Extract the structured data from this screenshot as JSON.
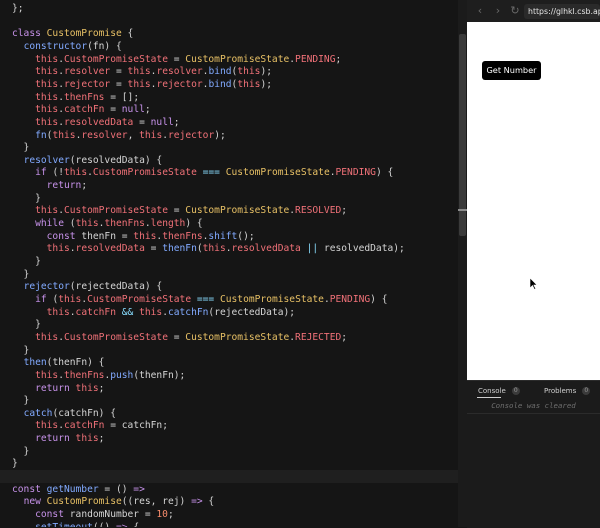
{
  "editor": {
    "lines": [
      [
        [
          "p",
          "};"
        ]
      ],
      [
        [
          "p",
          ""
        ]
      ],
      [
        [
          "k",
          "class "
        ],
        [
          "c",
          "CustomPromise"
        ],
        [
          "p",
          " {"
        ]
      ],
      [
        [
          "p",
          "  "
        ],
        [
          "f",
          "constructor"
        ],
        [
          "p",
          "(fn) {"
        ]
      ],
      [
        [
          "p",
          "    "
        ],
        [
          "t",
          "this"
        ],
        [
          "p",
          "."
        ],
        [
          "r",
          "CustomPromiseState"
        ],
        [
          "p",
          " = "
        ],
        [
          "c",
          "CustomPromiseState"
        ],
        [
          "p",
          "."
        ],
        [
          "r",
          "PENDING"
        ],
        [
          "p",
          ";"
        ]
      ],
      [
        [
          "p",
          "    "
        ],
        [
          "t",
          "this"
        ],
        [
          "p",
          "."
        ],
        [
          "r",
          "resolver"
        ],
        [
          "p",
          " = "
        ],
        [
          "t",
          "this"
        ],
        [
          "p",
          "."
        ],
        [
          "r",
          "resolver"
        ],
        [
          "p",
          "."
        ],
        [
          "f",
          "bind"
        ],
        [
          "p",
          "("
        ],
        [
          "t",
          "this"
        ],
        [
          "p",
          ");"
        ]
      ],
      [
        [
          "p",
          "    "
        ],
        [
          "t",
          "this"
        ],
        [
          "p",
          "."
        ],
        [
          "r",
          "rejector"
        ],
        [
          "p",
          " = "
        ],
        [
          "t",
          "this"
        ],
        [
          "p",
          "."
        ],
        [
          "r",
          "rejector"
        ],
        [
          "p",
          "."
        ],
        [
          "f",
          "bind"
        ],
        [
          "p",
          "("
        ],
        [
          "t",
          "this"
        ],
        [
          "p",
          ");"
        ]
      ],
      [
        [
          "p",
          "    "
        ],
        [
          "t",
          "this"
        ],
        [
          "p",
          "."
        ],
        [
          "r",
          "thenFns"
        ],
        [
          "p",
          " = [];"
        ]
      ],
      [
        [
          "p",
          "    "
        ],
        [
          "t",
          "this"
        ],
        [
          "p",
          "."
        ],
        [
          "r",
          "catchFn"
        ],
        [
          "p",
          " = "
        ],
        [
          "k",
          "null"
        ],
        [
          "p",
          ";"
        ]
      ],
      [
        [
          "p",
          "    "
        ],
        [
          "t",
          "this"
        ],
        [
          "p",
          "."
        ],
        [
          "r",
          "resolvedData"
        ],
        [
          "p",
          " = "
        ],
        [
          "k",
          "null"
        ],
        [
          "p",
          ";"
        ]
      ],
      [
        [
          "p",
          "    "
        ],
        [
          "f",
          "fn"
        ],
        [
          "p",
          "("
        ],
        [
          "t",
          "this"
        ],
        [
          "p",
          "."
        ],
        [
          "r",
          "resolver"
        ],
        [
          "p",
          ", "
        ],
        [
          "t",
          "this"
        ],
        [
          "p",
          "."
        ],
        [
          "r",
          "rejector"
        ],
        [
          "p",
          ");"
        ]
      ],
      [
        [
          "p",
          "  }"
        ]
      ],
      [
        [
          "p",
          "  "
        ],
        [
          "f",
          "resolver"
        ],
        [
          "p",
          "(resolvedData) {"
        ]
      ],
      [
        [
          "p",
          "    "
        ],
        [
          "k",
          "if"
        ],
        [
          "p",
          " (!"
        ],
        [
          "t",
          "this"
        ],
        [
          "p",
          "."
        ],
        [
          "r",
          "CustomPromiseState"
        ],
        [
          "o",
          " === "
        ],
        [
          "c",
          "CustomPromiseState"
        ],
        [
          "p",
          "."
        ],
        [
          "r",
          "PENDING"
        ],
        [
          "p",
          ") {"
        ]
      ],
      [
        [
          "p",
          "      "
        ],
        [
          "k",
          "return"
        ],
        [
          "p",
          ";"
        ]
      ],
      [
        [
          "p",
          "    }"
        ]
      ],
      [
        [
          "p",
          "    "
        ],
        [
          "t",
          "this"
        ],
        [
          "p",
          "."
        ],
        [
          "r",
          "CustomPromiseState"
        ],
        [
          "p",
          " = "
        ],
        [
          "c",
          "CustomPromiseState"
        ],
        [
          "p",
          "."
        ],
        [
          "r",
          "RESOLVED"
        ],
        [
          "p",
          ";"
        ]
      ],
      [
        [
          "p",
          "    "
        ],
        [
          "k",
          "while"
        ],
        [
          "p",
          " ("
        ],
        [
          "t",
          "this"
        ],
        [
          "p",
          "."
        ],
        [
          "r",
          "thenFns"
        ],
        [
          "p",
          "."
        ],
        [
          "r",
          "length"
        ],
        [
          "p",
          ") {"
        ]
      ],
      [
        [
          "p",
          "      "
        ],
        [
          "k",
          "const "
        ],
        [
          "p",
          "thenFn = "
        ],
        [
          "t",
          "this"
        ],
        [
          "p",
          "."
        ],
        [
          "r",
          "thenFns"
        ],
        [
          "p",
          "."
        ],
        [
          "f",
          "shift"
        ],
        [
          "p",
          "();"
        ]
      ],
      [
        [
          "p",
          "      "
        ],
        [
          "t",
          "this"
        ],
        [
          "p",
          "."
        ],
        [
          "r",
          "resolvedData"
        ],
        [
          "p",
          " = "
        ],
        [
          "f",
          "thenFn"
        ],
        [
          "p",
          "("
        ],
        [
          "t",
          "this"
        ],
        [
          "p",
          "."
        ],
        [
          "r",
          "resolvedData"
        ],
        [
          "o",
          " || "
        ],
        [
          "p",
          "resolvedData);"
        ]
      ],
      [
        [
          "p",
          "    }"
        ]
      ],
      [
        [
          "p",
          "  }"
        ]
      ],
      [
        [
          "p",
          "  "
        ],
        [
          "f",
          "rejector"
        ],
        [
          "p",
          "(rejectedData) {"
        ]
      ],
      [
        [
          "p",
          "    "
        ],
        [
          "k",
          "if"
        ],
        [
          "p",
          " ("
        ],
        [
          "t",
          "this"
        ],
        [
          "p",
          "."
        ],
        [
          "r",
          "CustomPromiseState"
        ],
        [
          "o",
          " === "
        ],
        [
          "c",
          "CustomPromiseState"
        ],
        [
          "p",
          "."
        ],
        [
          "r",
          "PENDING"
        ],
        [
          "p",
          ") {"
        ]
      ],
      [
        [
          "p",
          "      "
        ],
        [
          "t",
          "this"
        ],
        [
          "p",
          "."
        ],
        [
          "r",
          "catchFn"
        ],
        [
          "o",
          " && "
        ],
        [
          "t",
          "this"
        ],
        [
          "p",
          "."
        ],
        [
          "f",
          "catchFn"
        ],
        [
          "p",
          "(rejectedData);"
        ]
      ],
      [
        [
          "p",
          "    }"
        ]
      ],
      [
        [
          "p",
          "    "
        ],
        [
          "t",
          "this"
        ],
        [
          "p",
          "."
        ],
        [
          "r",
          "CustomPromiseState"
        ],
        [
          "p",
          " = "
        ],
        [
          "c",
          "CustomPromiseState"
        ],
        [
          "p",
          "."
        ],
        [
          "r",
          "REJECTED"
        ],
        [
          "p",
          ";"
        ]
      ],
      [
        [
          "p",
          "  }"
        ]
      ],
      [
        [
          "p",
          "  "
        ],
        [
          "f",
          "then"
        ],
        [
          "p",
          "(thenFn) {"
        ]
      ],
      [
        [
          "p",
          "    "
        ],
        [
          "t",
          "this"
        ],
        [
          "p",
          "."
        ],
        [
          "r",
          "thenFns"
        ],
        [
          "p",
          "."
        ],
        [
          "f",
          "push"
        ],
        [
          "p",
          "(thenFn);"
        ]
      ],
      [
        [
          "p",
          "    "
        ],
        [
          "k",
          "return "
        ],
        [
          "t",
          "this"
        ],
        [
          "p",
          ";"
        ]
      ],
      [
        [
          "p",
          "  }"
        ]
      ],
      [
        [
          "p",
          "  "
        ],
        [
          "f",
          "catch"
        ],
        [
          "p",
          "(catchFn) {"
        ]
      ],
      [
        [
          "p",
          "    "
        ],
        [
          "t",
          "this"
        ],
        [
          "p",
          "."
        ],
        [
          "r",
          "catchFn"
        ],
        [
          "p",
          " = catchFn;"
        ]
      ],
      [
        [
          "p",
          "    "
        ],
        [
          "k",
          "return "
        ],
        [
          "t",
          "this"
        ],
        [
          "p",
          ";"
        ]
      ],
      [
        [
          "p",
          "  }"
        ]
      ],
      [
        [
          "p",
          "}"
        ]
      ],
      [
        [
          "p",
          ""
        ]
      ],
      [
        [
          "k",
          "const "
        ],
        [
          "f",
          "getNumber"
        ],
        [
          "p",
          " = () "
        ],
        [
          "k",
          "=>"
        ]
      ],
      [
        [
          "p",
          "  "
        ],
        [
          "k",
          "new "
        ],
        [
          "c",
          "CustomPromise"
        ],
        [
          "p",
          "((res, rej) "
        ],
        [
          "k",
          "=>"
        ],
        [
          "p",
          " {"
        ]
      ],
      [
        [
          "p",
          "    "
        ],
        [
          "k",
          "const "
        ],
        [
          "p",
          "randomNumber = "
        ],
        [
          "n",
          "10"
        ],
        [
          "p",
          ";"
        ]
      ],
      [
        [
          "p",
          "    "
        ],
        [
          "f",
          "setTimeout"
        ],
        [
          "p",
          "(() "
        ],
        [
          "k",
          "=>"
        ],
        [
          "p",
          " {"
        ]
      ]
    ]
  },
  "browser": {
    "back_icon": "chevron-left-icon",
    "forward_icon": "chevron-right-icon",
    "refresh_icon": "refresh-icon",
    "url": "https://glhkl.csb.app/",
    "button_label": "Get Number"
  },
  "console": {
    "tab_console": "Console",
    "console_count": "0",
    "tab_problems": "Problems",
    "problems_count": "0",
    "message": "Console was cleared"
  },
  "colors": {
    "editor_bg": "#151515",
    "keyword": "#c792ea",
    "class": "#e7c065",
    "function": "#82aaff",
    "property": "#f07178",
    "operator": "#89ddff",
    "number": "#f78c6c",
    "preview_bg": "#ffffff"
  }
}
